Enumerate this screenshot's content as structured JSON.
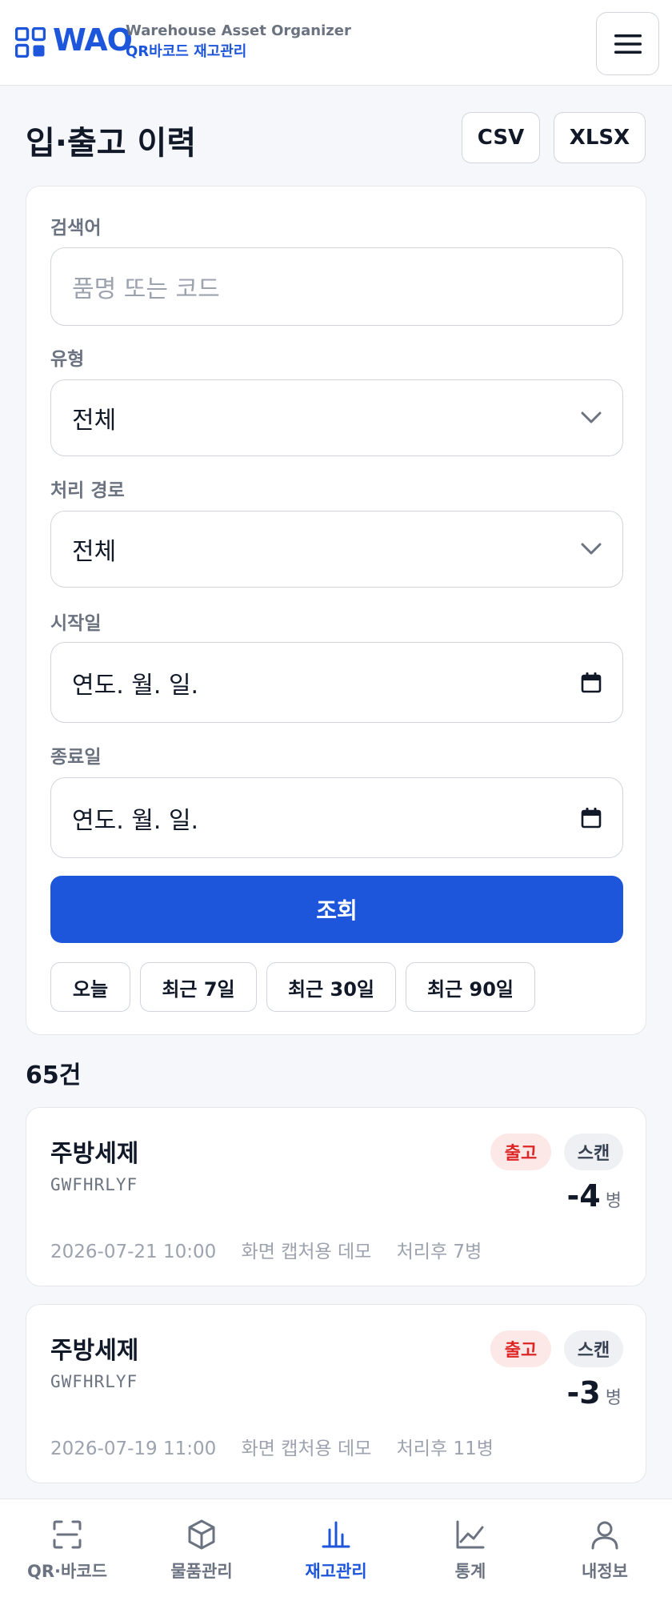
{
  "header": {
    "logo": "WAO",
    "subtitle_line1": "Warehouse Asset Organizer",
    "subtitle_line2": "QR바코드 재고관리",
    "menu_icon": "hamburger-icon"
  },
  "page": {
    "title": "입·출고 이력",
    "export_buttons": [
      "CSV",
      "XLSX"
    ]
  },
  "filters": {
    "search_label": "검색어",
    "search_placeholder": "품명 또는 코드",
    "type_label": "유형",
    "type_value": "전체",
    "route_label": "처리 경로",
    "route_value": "전체",
    "start_label": "시작일",
    "start_value": "연도. 월. 일.",
    "end_label": "종료일",
    "end_value": "연도. 월. 일.",
    "submit_label": "조회",
    "quick_ranges": [
      "오늘",
      "최근 7일",
      "최근 30일",
      "최근 90일"
    ]
  },
  "results": {
    "count": "65건",
    "records": [
      {
        "name": "주방세제",
        "code": "GWFHRLYF",
        "type_badge": "출고",
        "route_badge": "스캔",
        "quantity": "-4",
        "unit": "병",
        "datetime": "2026-07-21 10:00",
        "memo": "화면 캡처용 데모",
        "after": "처리후 7병"
      },
      {
        "name": "주방세제",
        "code": "GWFHRLYF",
        "type_badge": "출고",
        "route_badge": "스캔",
        "quantity": "-3",
        "unit": "병",
        "datetime": "2026-07-19 11:00",
        "memo": "화면 캡처용 데모",
        "after": "처리후 11병"
      }
    ]
  },
  "nav": {
    "items": [
      {
        "label": "QR·바코드",
        "icon": "scan-icon"
      },
      {
        "label": "물품관리",
        "icon": "box-icon"
      },
      {
        "label": "재고관리",
        "icon": "bar-chart-icon",
        "active": true
      },
      {
        "label": "통계",
        "icon": "line-chart-icon"
      },
      {
        "label": "내정보",
        "icon": "user-icon"
      }
    ]
  },
  "colors": {
    "brand": "#1d56db",
    "out_badge_bg": "#fde8e8",
    "out_badge_text": "#dc2626"
  }
}
